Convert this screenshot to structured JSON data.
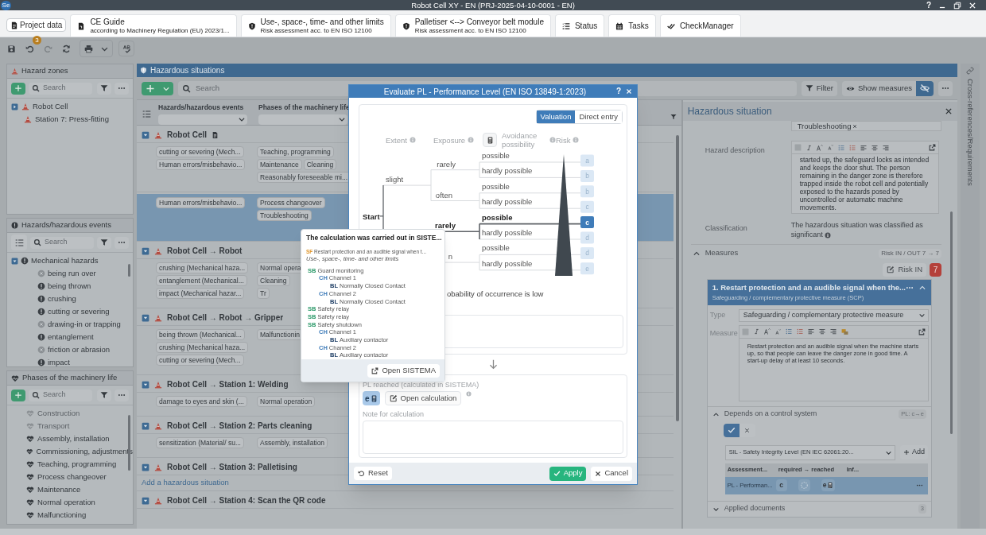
{
  "window": {
    "app_icon": "Se",
    "title": "Robot Cell XY - EN (PRJ-2025-04-10-0001 - EN)",
    "help": "?"
  },
  "tabs": [
    {
      "kind": "project",
      "label": "Project data"
    },
    {
      "kind": "guide",
      "label": "CE Guide",
      "subtitle": "according to Machinery Regulation (EU) 2023/1..."
    },
    {
      "kind": "shield",
      "label": "Use-, space-, time- and other limits",
      "subtitle": "Risk assessment acc. to EN ISO 12100"
    },
    {
      "kind": "shield",
      "label": "Palletiser <--> Conveyor belt module",
      "subtitle": "Risk assessment acc. to EN ISO 12100"
    },
    {
      "kind": "status",
      "label": "Status"
    },
    {
      "kind": "tasks",
      "label": "Tasks"
    },
    {
      "kind": "check",
      "label": "CheckManager"
    }
  ],
  "toolbar": {
    "undo_count": "3"
  },
  "hazard_zones": {
    "title": "Hazard zones",
    "search_placeholder": "Search",
    "items": [
      {
        "label": "Robot Cell",
        "kind": "collapsed"
      },
      {
        "label": "Station 7:  Press-fitting",
        "kind": "leaf"
      }
    ]
  },
  "hazards": {
    "title": "Hazards/hazardous events",
    "search_placeholder": "Search",
    "items": [
      {
        "label": "Mechanical hazards",
        "kind": "expanded",
        "children": [
          {
            "label": "being run over",
            "active": false
          },
          {
            "label": "being thrown",
            "active": true
          },
          {
            "label": "crushing",
            "active": true
          },
          {
            "label": "cutting or severing",
            "active": true
          },
          {
            "label": "drawing-in or trapping",
            "active": false
          },
          {
            "label": "entanglement",
            "active": true
          },
          {
            "label": "friction or abrasion",
            "active": false
          },
          {
            "label": "impact",
            "active": true
          }
        ]
      }
    ]
  },
  "phases": {
    "title": "Phases of the machinery life",
    "search_placeholder": "Search",
    "items": [
      {
        "label": "Construction",
        "active": false
      },
      {
        "label": "Transport",
        "active": false
      },
      {
        "label": "Assembly,  installation",
        "active": true
      },
      {
        "label": "Commissioning, adjustments",
        "active": true
      },
      {
        "label": "Teaching, programming",
        "active": true
      },
      {
        "label": "Process changeover",
        "active": true
      },
      {
        "label": "Maintenance",
        "active": true
      },
      {
        "label": "Normal operation",
        "active": true
      },
      {
        "label": "Malfunctioning",
        "active": true
      }
    ]
  },
  "hazardous_situations": {
    "title": "Hazardous situations",
    "search_placeholder": "Search",
    "filter_label": "Filter",
    "show_measures_label": "Show measures",
    "hide_measures_on": true,
    "columns": [
      "Hazards/hazardous events",
      "Phases of the machinery life"
    ],
    "groups": [
      {
        "title": "Robot Cell",
        "has_document": true,
        "rows": [
          {
            "selected": false,
            "hazards": [
              "cutting or severing (Mech...",
              "Human errors/misbehavio..."
            ],
            "phases": [
              "Teaching, programming",
              "Maintenance",
              "Cleaning",
              "Reasonably foreseeable mi..."
            ]
          },
          {
            "selected": true,
            "hazards": [
              "Human errors/misbehavio..."
            ],
            "phases": [
              "Process changeover",
              "Troubleshooting"
            ]
          }
        ]
      },
      {
        "title": "Robot Cell → Robot",
        "rows": [
          {
            "selected": false,
            "hazards": [
              "crushing (Mechanical haza...",
              "entanglement (Mechanical...",
              "impact (Mechanical hazar..."
            ],
            "phases": [
              "Normal opera",
              "Cleaning",
              "Tr"
            ]
          }
        ]
      },
      {
        "title": "Robot Cell → Robot → Gripper",
        "rows": [
          {
            "selected": false,
            "hazards": [
              "being thrown (Mechanical...",
              "crushing (Mechanical haza...",
              "cutting or severing (Mech..."
            ],
            "phases": [
              "Malfunctionin"
            ]
          }
        ]
      },
      {
        "title": "Robot Cell → Station 1: Welding",
        "rows": [
          {
            "selected": false,
            "hazards": [
              "damage to eyes and skin (..."
            ],
            "phases": [
              "Normal operation"
            ]
          }
        ]
      },
      {
        "title": "Robot Cell → Station 2: Parts cleaning",
        "rows": [
          {
            "selected": false,
            "hazards": [
              "sensitization (Material/ su..."
            ],
            "phases": [
              "Assembly,  installation"
            ]
          }
        ]
      },
      {
        "title": "Robot Cell → Station 3: Palletising",
        "add_link": "Add a hazardous situation"
      },
      {
        "title": "Robot Cell → Station 4: Scan the QR code"
      }
    ]
  },
  "pl_dialog": {
    "title": "Evaluate PL - Performance Level (EN ISO 13849-1:2023)",
    "help": "?",
    "modes": [
      {
        "label": "Valuation",
        "selected": true
      },
      {
        "label": "Direct entry",
        "selected": false
      }
    ],
    "headings": [
      "Extent",
      "Exposure",
      "Avoidance possibility",
      "Risk"
    ],
    "tree": {
      "start": "Start",
      "extents": [
        {
          "label": "slight",
          "exposures": [
            {
              "label": "rarely",
              "selected": false,
              "avoidance": [
                {
                  "label": "possible",
                  "selected": false,
                  "risk": "a"
                },
                {
                  "label": "hardly possible",
                  "selected": false,
                  "risk": "b"
                }
              ]
            },
            {
              "label": "often",
              "selected": false,
              "avoidance": [
                {
                  "label": "possible",
                  "selected": false,
                  "risk": "b"
                },
                {
                  "label": "hardly possible",
                  "selected": false,
                  "risk": "c"
                }
              ]
            }
          ]
        },
        {
          "exposures": [
            {
              "label": "rarely",
              "selected": true,
              "avoidance": [
                {
                  "label": "possible",
                  "selected": true,
                  "risk": "c"
                },
                {
                  "label": "hardly possible",
                  "selected": false,
                  "risk": "d"
                }
              ]
            },
            {
              "label": "n",
              "selected": false,
              "avoidance": [
                {
                  "label": "possible",
                  "selected": false,
                  "risk": "d"
                },
                {
                  "label": "hardly possible",
                  "selected": false,
                  "risk": "e"
                }
              ]
            }
          ]
        }
      ]
    },
    "note_text": "obability of occurrence is low",
    "reached_label": "PL reached (calculated in SISTEMA)",
    "reached_value": "e",
    "open_calculation": "Open calculation",
    "note_label": "Note for calculation",
    "reset": "Reset",
    "apply": "Apply",
    "cancel": "Cancel"
  },
  "sistema_tooltip": {
    "title": "The calculation was carried out in SISTE...",
    "function_code": "SF",
    "function_label": "Restart protection and an audible signal when t...",
    "context": "Use-, space-, time- and other limits",
    "blocks": [
      {
        "kind": "sb",
        "code": "SB",
        "label": "Guard monitoring",
        "children": [
          {
            "kind": "ch",
            "code": "CH",
            "label": "Channel 1",
            "children": [
              {
                "kind": "bl",
                "code": "BL",
                "label": "Normally Closed Contact"
              }
            ]
          },
          {
            "kind": "ch",
            "code": "CH",
            "label": "Channel 2",
            "children": [
              {
                "kind": "bl",
                "code": "BL",
                "label": "Normally Closed Contact"
              }
            ]
          }
        ]
      },
      {
        "kind": "sb",
        "code": "SB",
        "label": "Safety relay"
      },
      {
        "kind": "sb",
        "code": "SB",
        "label": "Safety relay"
      },
      {
        "kind": "sb",
        "code": "SB",
        "label": "Safety shutdown",
        "children": [
          {
            "kind": "ch",
            "code": "CH",
            "label": "Channel 1",
            "children": [
              {
                "kind": "bl",
                "code": "BL",
                "label": "Auxiliary contactor"
              }
            ]
          },
          {
            "kind": "ch",
            "code": "CH",
            "label": "Channel 2",
            "children": [
              {
                "kind": "bl",
                "code": "BL",
                "label": "Auxiliary contactor"
              }
            ]
          }
        ]
      }
    ],
    "open_button": "Open SISTEMA"
  },
  "detail": {
    "title": "Hazardous situation",
    "phase_chips": [
      "Troubleshooting"
    ],
    "description_label": "Hazard description",
    "description": "started up, the safeguard locks as intended and keeps the door shut. The person remaining in the danger zone is therefore trapped inside the robot cell and potentially exposed to the hazards posed by uncontrolled or automatic machine movements.",
    "classification_label": "Classification",
    "classification": "The hazardous situation was classified as significant",
    "measures": {
      "label": "Measures",
      "expanded": true,
      "risk_summary": "Risk IN / OUT 7 → 7",
      "risk_in_button": "Risk IN",
      "risk_value": "7",
      "items": [
        {
          "title": "1. Restart protection and an audible signal when the...",
          "subtitle": "Safeguarding / complementary protective measure (SCP)",
          "type_label": "Type",
          "type": "Safeguarding / complementary protective measure",
          "measure_label": "Measure",
          "measure": "Restart protection and an audible signal when the machine starts up, so that people can leave the danger zone in good time. A start-up delay of at least 10 seconds.",
          "control_label": "Depends on a control system",
          "control_expanded": true,
          "pl_range": "PL: c→e",
          "depends": true,
          "standard": "SIL - Safety Integrity Level (EN IEC 62061:20...",
          "add_label": "Add",
          "columns": [
            "Assessment...",
            "required → reached",
            "Inf..."
          ],
          "assessments": [
            {
              "name": "PL - Performan...",
              "required": "c",
              "reached": "e"
            }
          ],
          "documents_label": "Applied documents",
          "documents_count": "3",
          "documents_expanded": false
        }
      ]
    }
  },
  "sidebar_tab": "Cross-references/Requirements"
}
